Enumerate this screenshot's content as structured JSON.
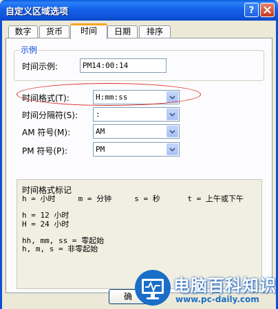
{
  "window": {
    "title": "自定义区域选项"
  },
  "tabs": [
    {
      "label": "数字"
    },
    {
      "label": "货币"
    },
    {
      "label": "时间"
    },
    {
      "label": "日期"
    },
    {
      "label": "排序"
    }
  ],
  "example": {
    "caption": "示例",
    "sample_label": "时间示例:",
    "sample_value": "PM14:00:14"
  },
  "fields": {
    "format_label": "时间格式(T):",
    "format_value": "H:mm:ss",
    "separator_label": "时间分隔符(S):",
    "separator_value": ":",
    "am_label": "AM 符号(M):",
    "am_value": "AM",
    "pm_label": "PM 符号(P):",
    "pm_value": "PM"
  },
  "notation": {
    "title": "时间格式标记",
    "line1": "h = 小时     m = 分钟     s = 秒      t = 上午或下午",
    "line2": "h = 12 小时",
    "line3": "H = 24 小时",
    "line4": "hh, mm, ss = 零起始",
    "line5": "h, m, s = 非零起始"
  },
  "buttons": {
    "ok_label": "确"
  },
  "watermark": {
    "name": "电脑百科知识",
    "url": "www.pc-daily.com"
  },
  "colors": {
    "title_bar": "#0F55DC",
    "group_caption": "#0046D5",
    "highlight_ellipse": "#E02424",
    "tab_active": "#F5A623"
  }
}
